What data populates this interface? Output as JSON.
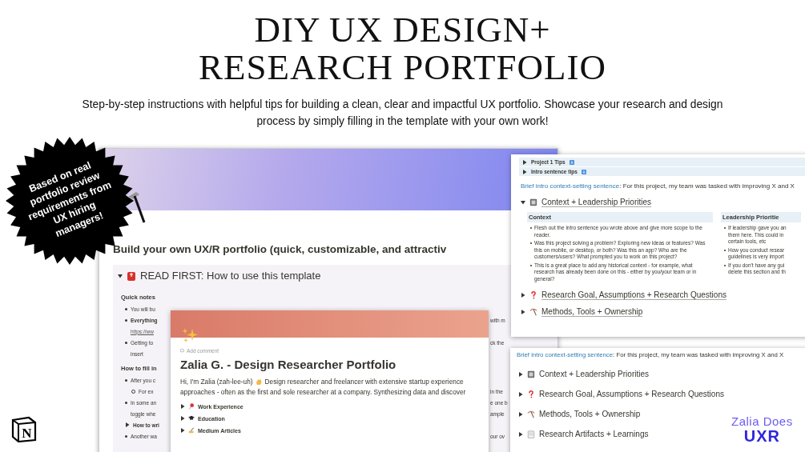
{
  "heading": {
    "title_lines": [
      "DIY UX DESIGN+",
      "RESEARCH PORTFOLIO"
    ],
    "subtitle": "Step-by-step instructions with helpful tips for building a clean, clear and impactful UX portfolio. Showcase your research and design process by simply filling in the template with your own work!"
  },
  "badge": {
    "text": "Based on real portfolio review requirements from UX hiring managers!"
  },
  "template_page": {
    "title": "Build your own UX/R portfolio (quick, customizable, and attractiv",
    "toggle": {
      "label": "READ FIRST: How to use this template",
      "expanded": true
    },
    "rows": [
      {
        "kind": "heading",
        "left": "Quick notes"
      },
      {
        "kind": "bullet",
        "left": "You will bu"
      },
      {
        "kind": "strong_bullet",
        "left": "Everything",
        "right": "with m"
      },
      {
        "kind": "link_line",
        "left": "https://ww"
      },
      {
        "kind": "bullet",
        "left": "Getting to",
        "right": "ck the"
      },
      {
        "kind": "line",
        "left": "insert"
      },
      {
        "kind": "heading",
        "left": "How to fill in"
      },
      {
        "kind": "bullet",
        "left": "After you c"
      },
      {
        "kind": "sub_bullet",
        "left": "For ex",
        "right": "in the"
      },
      {
        "kind": "bullet",
        "left": "In some an",
        "right": "e one b"
      },
      {
        "kind": "line",
        "left": "toggle whe",
        "right": "ample"
      },
      {
        "kind": "toggle",
        "left": "How to wri",
        "expanded": false
      },
      {
        "kind": "bullet",
        "left": "Another wa",
        "right": "our ov"
      }
    ]
  },
  "portfolio_page": {
    "add_comment": "Add comment",
    "title": "Zalia G. - Design Researcher Portfolio",
    "intro_start": "Hi, I'm Zalia (zah-lee-uh)",
    "intro_rest": "Design researcher and freelancer with extensive startup experience",
    "intro_line_2": "approaches - often as the first and sole researcher at a company. Synthesizing data and discover",
    "toggles": [
      {
        "kind": "pin",
        "label": "Work Experience",
        "expanded": false
      },
      {
        "kind": "cap",
        "label": "Education",
        "expanded": false
      },
      {
        "kind": "pen",
        "label": "Medium Articles",
        "expanded": false
      }
    ]
  },
  "project_page": {
    "tips": [
      {
        "label": "Project 1 Tips",
        "expanded": false
      },
      {
        "label": "Intro sentence tips",
        "expanded": false
      }
    ],
    "intro_label": "Brief intro context-setting sentence",
    "intro_text": ": For this project, my team was tasked with improving X and X",
    "sections": [
      {
        "kind": "book",
        "label": "Context + Leadership Priorities",
        "expanded": true
      },
      {
        "kind": "question",
        "label": "Research Goal, Assumptions + Research Questions",
        "expanded": false
      },
      {
        "kind": "pick",
        "label": "Methods, Tools + Ownership",
        "expanded": false
      }
    ],
    "context": {
      "heading": "Context",
      "bullets": [
        "Flesh out the intro sentence you wrote above and give more scope to the reader.",
        "Was this project solving a problem? Exploring new ideas or features? Was this on mobile, or desktop, or both? Was this an app? Who are the customers/users? What prompted you to work on this project?",
        "This is a great place to add any historical context - for example, what research has already been done on this - either by you/your team or in general?"
      ]
    },
    "leadership": {
      "heading": "Leadership Prioritie",
      "bullets": [
        [
          "If leadership gave you an",
          "them here. This could in",
          "certain tools, etc"
        ],
        [
          "How you conduct resear",
          "guidelines is very import"
        ],
        [
          "If you don't have any gui",
          "delete this section and th"
        ]
      ]
    }
  },
  "collapsed_page": {
    "intro_label": "Brief intro context-setting sentence",
    "intro_text": ": For this project, my team was tasked with improving X and X",
    "sections": [
      {
        "kind": "book",
        "label": "Context + Leadership Priorities",
        "expanded": false
      },
      {
        "kind": "question",
        "label": "Research Goal, Assumptions + Research Questions",
        "expanded": false
      },
      {
        "kind": "pick",
        "label": "Methods, Tools + Ownership",
        "expanded": false
      },
      {
        "kind": "notepad",
        "label": "Research Artifacts + Learnings",
        "expanded": false
      }
    ]
  },
  "notion_logo": {
    "letter": "N"
  },
  "brand_logo": {
    "line_1": "Zalia Does",
    "line_2": "UXR"
  }
}
